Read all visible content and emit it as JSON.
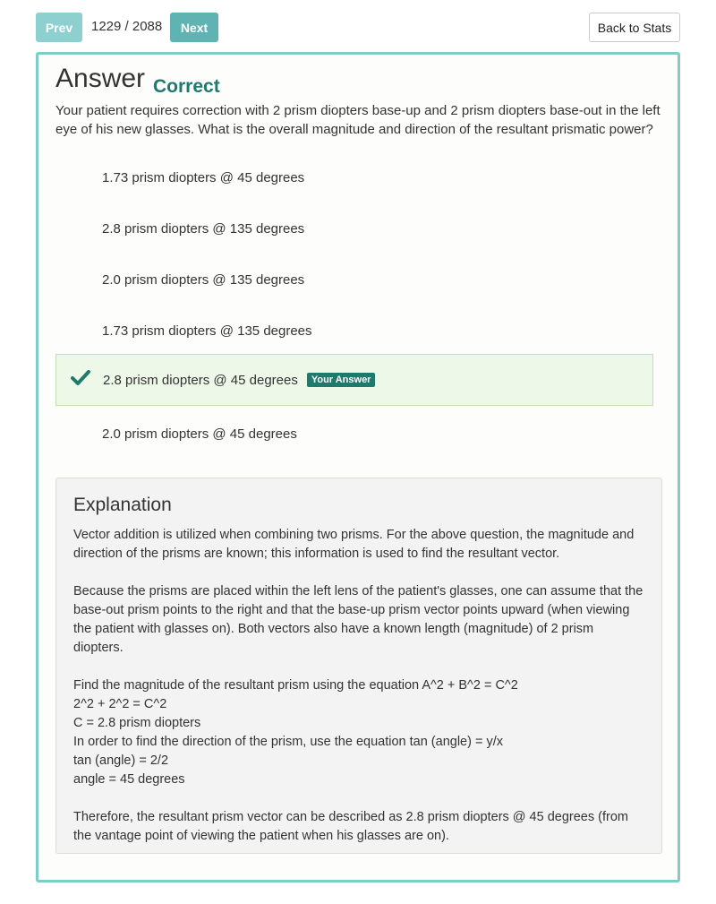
{
  "nav": {
    "prev_label": "Prev",
    "counter": "1229 / 2088",
    "next_label": "Next",
    "back_label": "Back to Stats"
  },
  "answer": {
    "heading": "Answer",
    "status": "Correct",
    "question": "Your patient requires correction with 2 prism diopters base-up and 2 prism diopters base-out in the left eye of his new glasses. What is the overall magnitude and direction of the resultant prismatic power?",
    "choices": [
      {
        "text": "1.73 prism diopters @ 45 degrees"
      },
      {
        "text": "2.8 prism diopters @ 135 degrees"
      },
      {
        "text": "2.0 prism diopters @ 135 degrees"
      },
      {
        "text": "1.73 prism diopters @ 135 degrees"
      },
      {
        "text": "2.8 prism diopters @ 45 degrees",
        "badge": "Your Answer"
      },
      {
        "text": "2.0 prism diopters @ 45 degrees"
      }
    ]
  },
  "explanation": {
    "title": "Explanation",
    "p1": "Vector addition is utilized when combining two prisms. For the above question, the magnitude and direction of the prisms are known; this information is used to find the resultant vector.",
    "p2": "Because the prisms are placed within the left lens of the patient's glasses, one can assume that the base-out prism points to the right and that the base-up prism vector points upward (when viewing the patient with glasses on). Both vectors also have a known length (magnitude) of 2 prism diopters.",
    "lines": [
      "Find the magnitude of the resultant prism using the equation A^2 + B^2 = C^2",
      "2^2 + 2^2 = C^2",
      "C = 2.8 prism diopters",
      "In order to find the direction of the prism, use the equation tan (angle) = y/x",
      "tan (angle) = 2/2",
      "angle = 45 degrees"
    ],
    "p3": "Therefore, the resultant prism vector can be described as 2.8 prism diopters @ 45 degrees (from the vantage point of viewing the patient when his glasses are on)."
  },
  "colors": {
    "accent": "#5fb3b3",
    "card_border": "#7dcdc8",
    "correct": "#1e7a6b",
    "selected_bg": "#eef8e9"
  }
}
